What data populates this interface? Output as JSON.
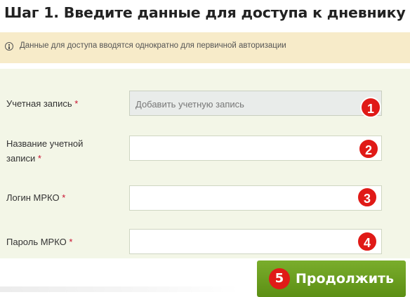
{
  "heading": "Шаг 1. Введите данные для доступа к дневнику",
  "notice": {
    "icon": "info-icon",
    "text": "Данные для доступа вводятся однократно для первичной авторизации"
  },
  "form": {
    "account": {
      "label": "Учетная запись",
      "required": "*",
      "value": "Добавить учетную запись",
      "badge": "1"
    },
    "account_name": {
      "label_line1": "Название учетной",
      "label_line2": "записи",
      "required": "*",
      "value": "",
      "badge": "2"
    },
    "login": {
      "label": "Логин МРКО",
      "required": "*",
      "value": "",
      "badge": "3"
    },
    "password": {
      "label": "Пароль МРКО",
      "required": "*",
      "value": "",
      "badge": "4"
    }
  },
  "continue_button": {
    "label": "Продолжить",
    "badge": "5"
  },
  "colors": {
    "accent_green": "#6a9e1f",
    "badge_red": "#e01a17",
    "notice_bg": "#f7ebc9",
    "form_bg": "#f3f6e7"
  }
}
